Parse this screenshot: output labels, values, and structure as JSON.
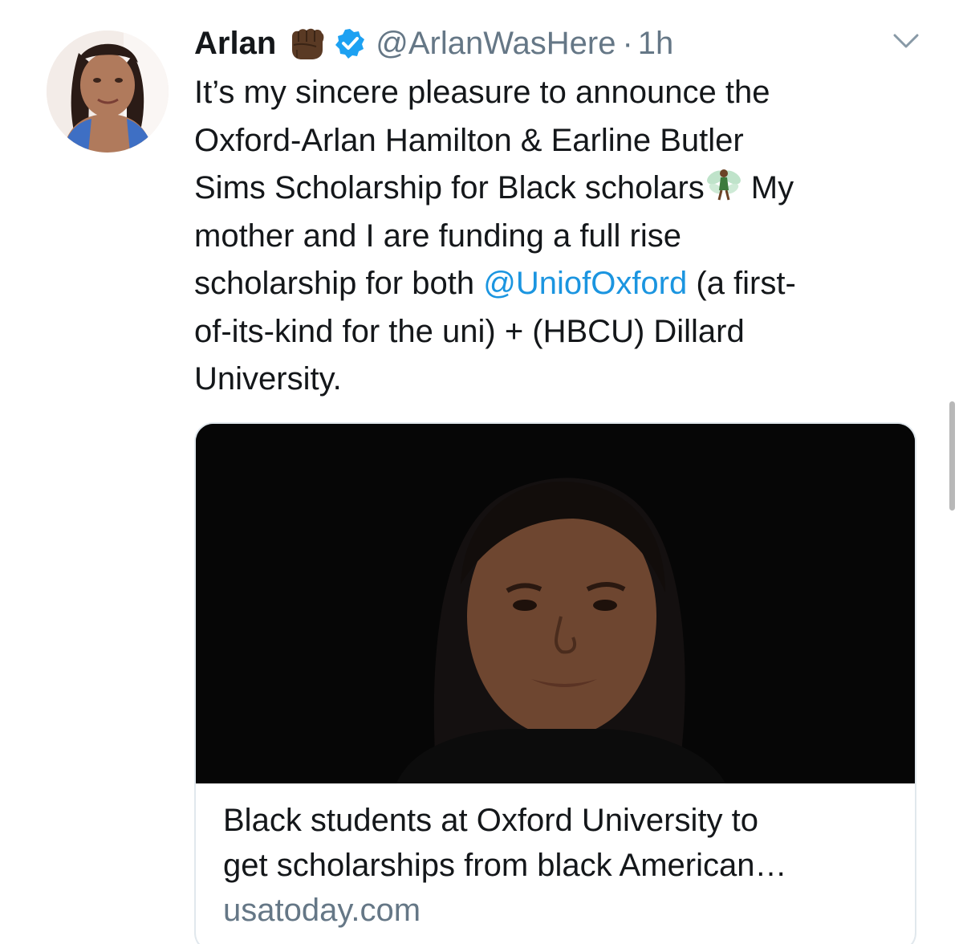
{
  "user": {
    "display_name": "Arlan",
    "handle": "@ArlanWasHere",
    "separator": "·",
    "timestamp": "1h",
    "verified": true,
    "name_emoji": "fist-icon"
  },
  "tweet": {
    "lines": [
      "It’s my sincere pleasure to announce the",
      "Oxford-Arlan Hamilton & Earline Butler",
      "Sims Scholarship for Black scholars",
      "My",
      "mother and I are funding a full rise",
      "scholarship for both",
      "@UniofOxford",
      "(a first-",
      "of-its-kind for the uni) + (HBCU) Dillard",
      "University."
    ],
    "emoji": "fairy-icon",
    "mention_color": "#1b95e0"
  },
  "card": {
    "title_lines": [
      "Black students at Oxford University to",
      "get scholarships from black American…"
    ],
    "domain": "usatoday.com"
  },
  "colors": {
    "text": "#14171a",
    "secondary": "#657786",
    "link": "#1b95e0",
    "verified": "#1da1f2",
    "card_border": "#e1e8ed"
  }
}
